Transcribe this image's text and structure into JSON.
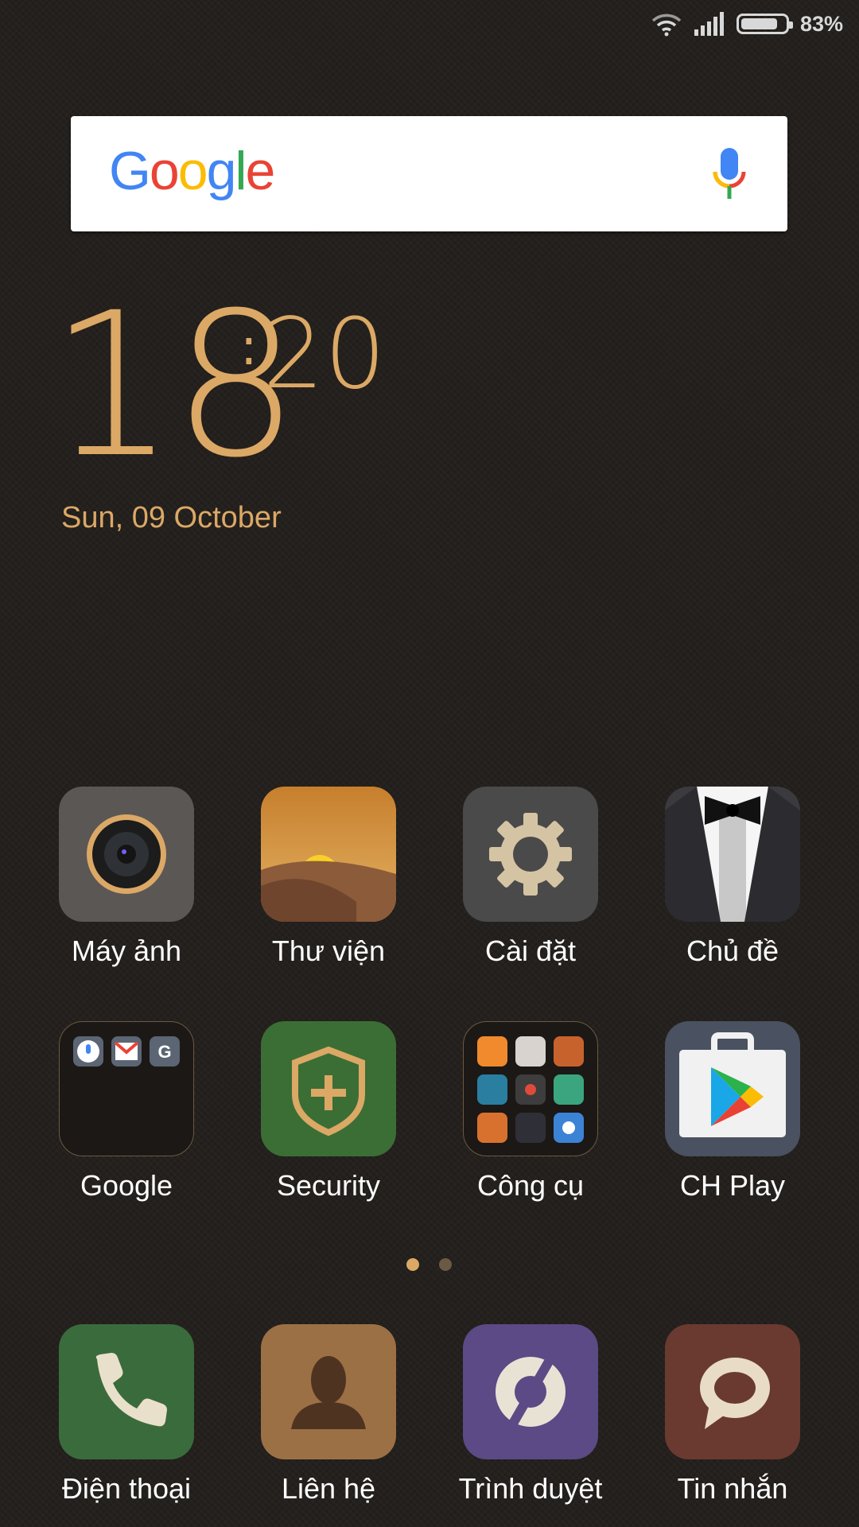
{
  "status_bar": {
    "battery_percent_text": "83%",
    "battery_level": 0.83,
    "wifi_icon": "wifi-icon",
    "signal_icon": "cellular-signal-icon"
  },
  "search_widget": {
    "logo_letters": [
      "G",
      "o",
      "o",
      "g",
      "l",
      "e"
    ],
    "logo_colors": [
      "#4285F4",
      "#EA4335",
      "#FBBC05",
      "#4285F4",
      "#34A853",
      "#EA4335"
    ],
    "mic_icon": "microphone-icon"
  },
  "clock": {
    "hour": "18",
    "colon": ":",
    "minute": "20",
    "date": "Sun, 09 October",
    "color": "#dba866"
  },
  "home_apps": [
    {
      "label": "Máy ảnh",
      "icon": "camera-icon"
    },
    {
      "label": "Thư viện",
      "icon": "gallery-icon"
    },
    {
      "label": "Cài đặt",
      "icon": "settings-gear-icon"
    },
    {
      "label": "Chủ đề",
      "icon": "themes-tuxedo-icon"
    },
    {
      "label": "Google",
      "icon": "google-folder-icon"
    },
    {
      "label": "Security",
      "icon": "security-shield-icon"
    },
    {
      "label": "Công cụ",
      "icon": "tools-folder-icon"
    },
    {
      "label": "CH Play",
      "icon": "play-store-icon"
    }
  ],
  "pages": {
    "count": 2,
    "current": 1
  },
  "dock_apps": [
    {
      "label": "Điện thoại",
      "icon": "phone-icon"
    },
    {
      "label": "Liên hệ",
      "icon": "contacts-icon"
    },
    {
      "label": "Trình duyệt",
      "icon": "browser-icon"
    },
    {
      "label": "Tin nhắn",
      "icon": "messages-icon"
    }
  ]
}
